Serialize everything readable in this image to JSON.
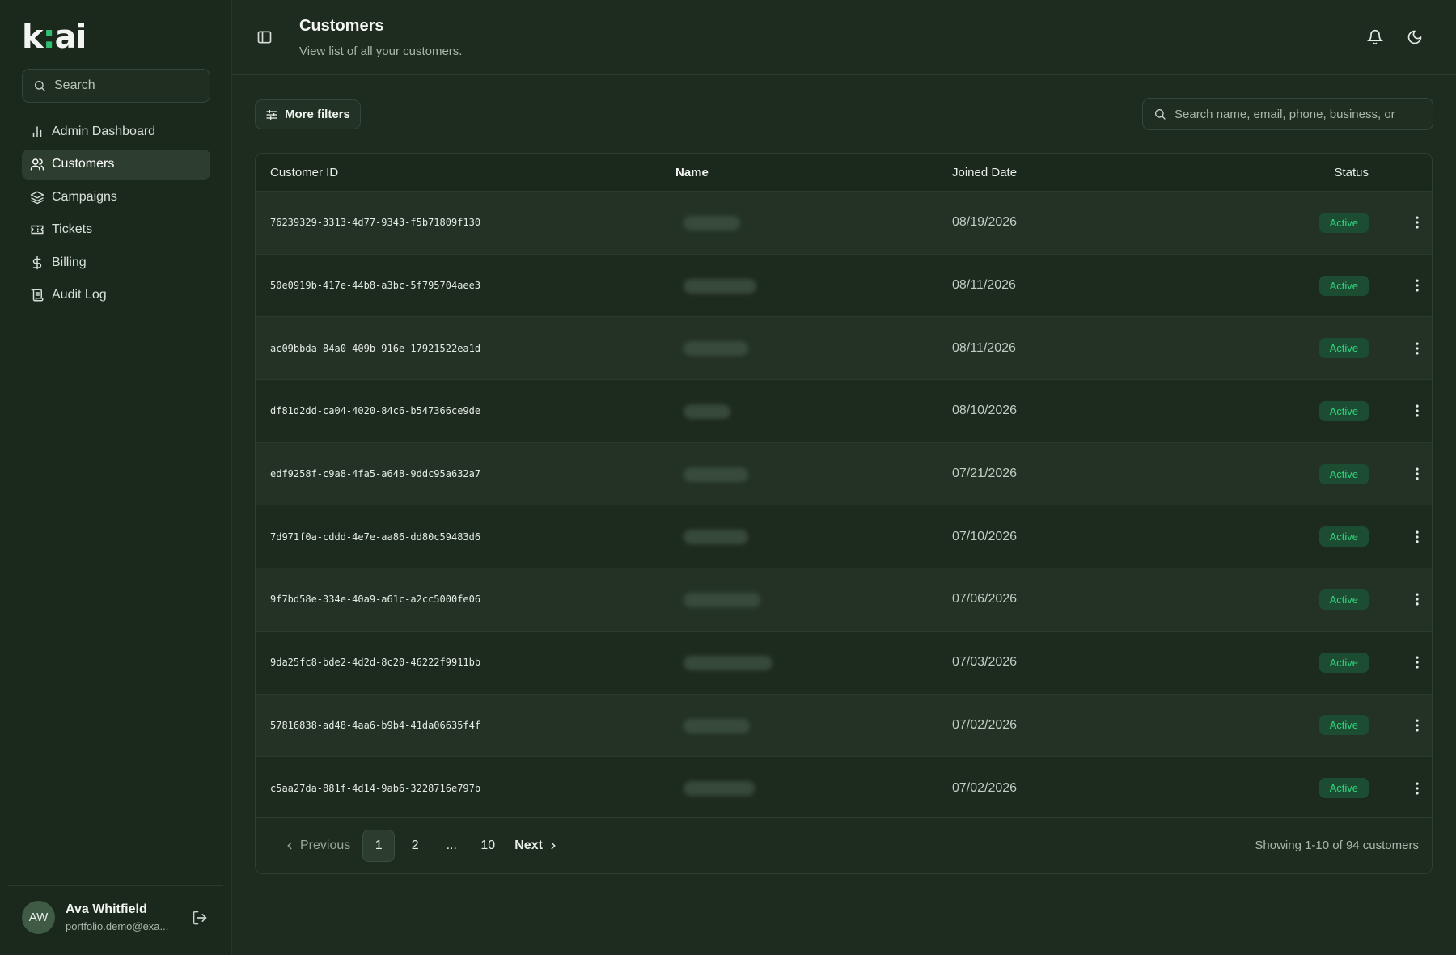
{
  "brand": {
    "logo_left": "k",
    "logo_dot": ":",
    "logo_right": "ai"
  },
  "sidebar": {
    "search_placeholder": "Search",
    "items": [
      {
        "label": "Admin Dashboard",
        "icon": "bar-chart-icon"
      },
      {
        "label": "Customers",
        "icon": "users-icon",
        "active": true
      },
      {
        "label": "Campaigns",
        "icon": "layers-icon"
      },
      {
        "label": "Tickets",
        "icon": "ticket-icon"
      },
      {
        "label": "Billing",
        "icon": "dollar-icon"
      },
      {
        "label": "Audit Log",
        "icon": "scroll-icon"
      }
    ],
    "user": {
      "initials": "AW",
      "name": "Ava Whitfield",
      "email": "portfolio.demo@exa..."
    }
  },
  "header": {
    "title": "Customers",
    "subtitle": "View list of all your customers."
  },
  "toolbar": {
    "filters_label": "More filters",
    "search_placeholder": "Search name, email, phone, business, or"
  },
  "table": {
    "columns": [
      "Customer ID",
      "Name",
      "Joined Date",
      "Status"
    ],
    "rows": [
      {
        "id": "76239329-3313-4d77-9343-f5b71809f130",
        "date": "08/19/2026",
        "status": "Active"
      },
      {
        "id": "50e0919b-417e-44b8-a3bc-5f795704aee3",
        "date": "08/11/2026",
        "status": "Active"
      },
      {
        "id": "ac09bbda-84a0-409b-916e-17921522ea1d",
        "date": "08/11/2026",
        "status": "Active"
      },
      {
        "id": "df81d2dd-ca04-4020-84c6-b547366ce9de",
        "date": "08/10/2026",
        "status": "Active"
      },
      {
        "id": "edf9258f-c9a8-4fa5-a648-9ddc95a632a7",
        "date": "07/21/2026",
        "status": "Active"
      },
      {
        "id": "7d971f0a-cddd-4e7e-aa86-dd80c59483d6",
        "date": "07/10/2026",
        "status": "Active"
      },
      {
        "id": "9f7bd58e-334e-40a9-a61c-a2cc5000fe06",
        "date": "07/06/2026",
        "status": "Active"
      },
      {
        "id": "9da25fc8-bde2-4d2d-8c20-46222f9911bb",
        "date": "07/03/2026",
        "status": "Active"
      },
      {
        "id": "57816838-ad48-4aa6-b9b4-41da06635f4f",
        "date": "07/02/2026",
        "status": "Active"
      },
      {
        "id": "c5aa27da-881f-4d14-9ab6-3228716e797b",
        "date": "07/02/2026",
        "status": "Active"
      }
    ]
  },
  "pagination": {
    "previous": "Previous",
    "pages": [
      "1",
      "2",
      "...",
      "10"
    ],
    "current": "1",
    "next": "Next",
    "info": "Showing 1-10 of 94 customers"
  },
  "colors": {
    "accent": "#34d47f",
    "badge_bg": "#1c4d33",
    "bg": "#1e2c1f"
  }
}
